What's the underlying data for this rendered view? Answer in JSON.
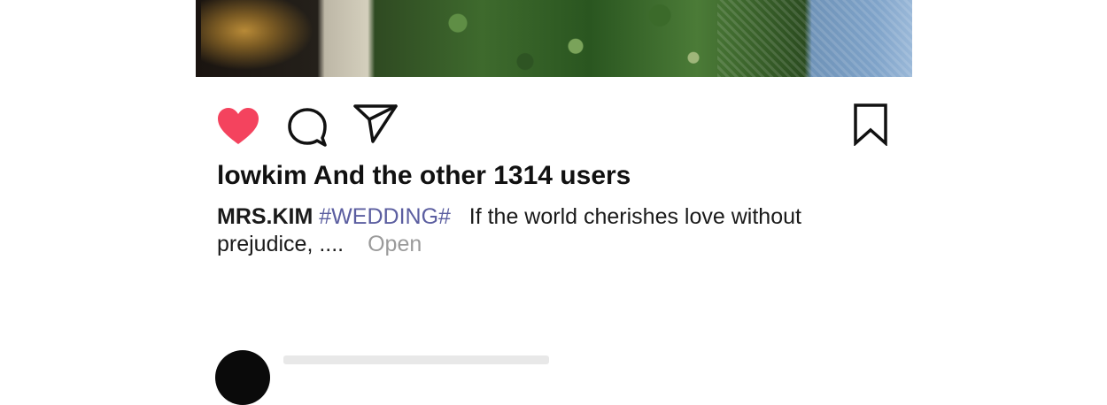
{
  "post": {
    "likes_text": "lowkim And the other 1314 users",
    "caption": {
      "username": "MRS.KIM",
      "hashtag": "#WEDDING#",
      "text": "If the world cherishes love without prejudice, ....",
      "more_label": "Open"
    }
  },
  "actions": {
    "like_icon": "heart-filled-icon",
    "comment_icon": "comment-bubble-icon",
    "share_icon": "send-paper-plane-icon",
    "save_icon": "bookmark-icon"
  },
  "colors": {
    "like_active": "#f4435e",
    "hashtag": "#5b5ea0",
    "more_link": "#9a9a9a"
  }
}
